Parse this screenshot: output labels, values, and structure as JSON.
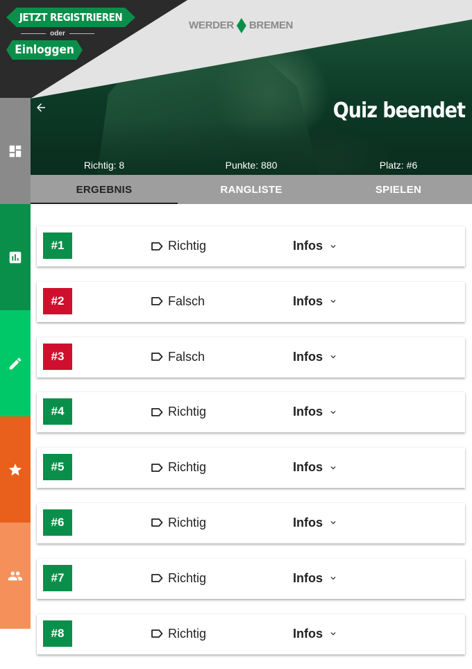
{
  "login": {
    "register_label": "JETZT REGISTRIEREN",
    "or_label": "oder",
    "login_label": "Einloggen"
  },
  "header": {
    "logo_left": "WERDER",
    "logo_right": "BREMEN",
    "back_icon": "arrow-left-icon",
    "title": "Quiz beendet",
    "stats": {
      "correct": "Richtig: 8",
      "points": "Punkte: 880",
      "rank": "Platz: #6"
    }
  },
  "tabs": [
    {
      "label": "ERGEBNIS",
      "active": true
    },
    {
      "label": "RANGLISTE",
      "active": false
    },
    {
      "label": "SPIELEN",
      "active": false
    }
  ],
  "sidebar": {
    "items": [
      {
        "icon": "dashboard-icon",
        "color": "#8a8a8a"
      },
      {
        "icon": "bar-chart-icon",
        "color": "#0a8f4a"
      },
      {
        "icon": "pencil-icon",
        "color": "#00c767"
      },
      {
        "icon": "star-icon",
        "color": "#e8601c"
      },
      {
        "icon": "people-icon",
        "color": "#f5905a"
      }
    ]
  },
  "colors": {
    "correct": "#0a8f4a",
    "wrong": "#cf102d",
    "accent": "#0a8f4a"
  },
  "results": [
    {
      "number": "#1",
      "status": "Richtig",
      "correct": true,
      "info_label": "Infos"
    },
    {
      "number": "#2",
      "status": "Falsch",
      "correct": false,
      "info_label": "Infos"
    },
    {
      "number": "#3",
      "status": "Falsch",
      "correct": false,
      "info_label": "Infos"
    },
    {
      "number": "#4",
      "status": "Richtig",
      "correct": true,
      "info_label": "Infos"
    },
    {
      "number": "#5",
      "status": "Richtig",
      "correct": true,
      "info_label": "Infos"
    },
    {
      "number": "#6",
      "status": "Richtig",
      "correct": true,
      "info_label": "Infos"
    },
    {
      "number": "#7",
      "status": "Richtig",
      "correct": true,
      "info_label": "Infos"
    },
    {
      "number": "#8",
      "status": "Richtig",
      "correct": true,
      "info_label": "Infos"
    }
  ]
}
